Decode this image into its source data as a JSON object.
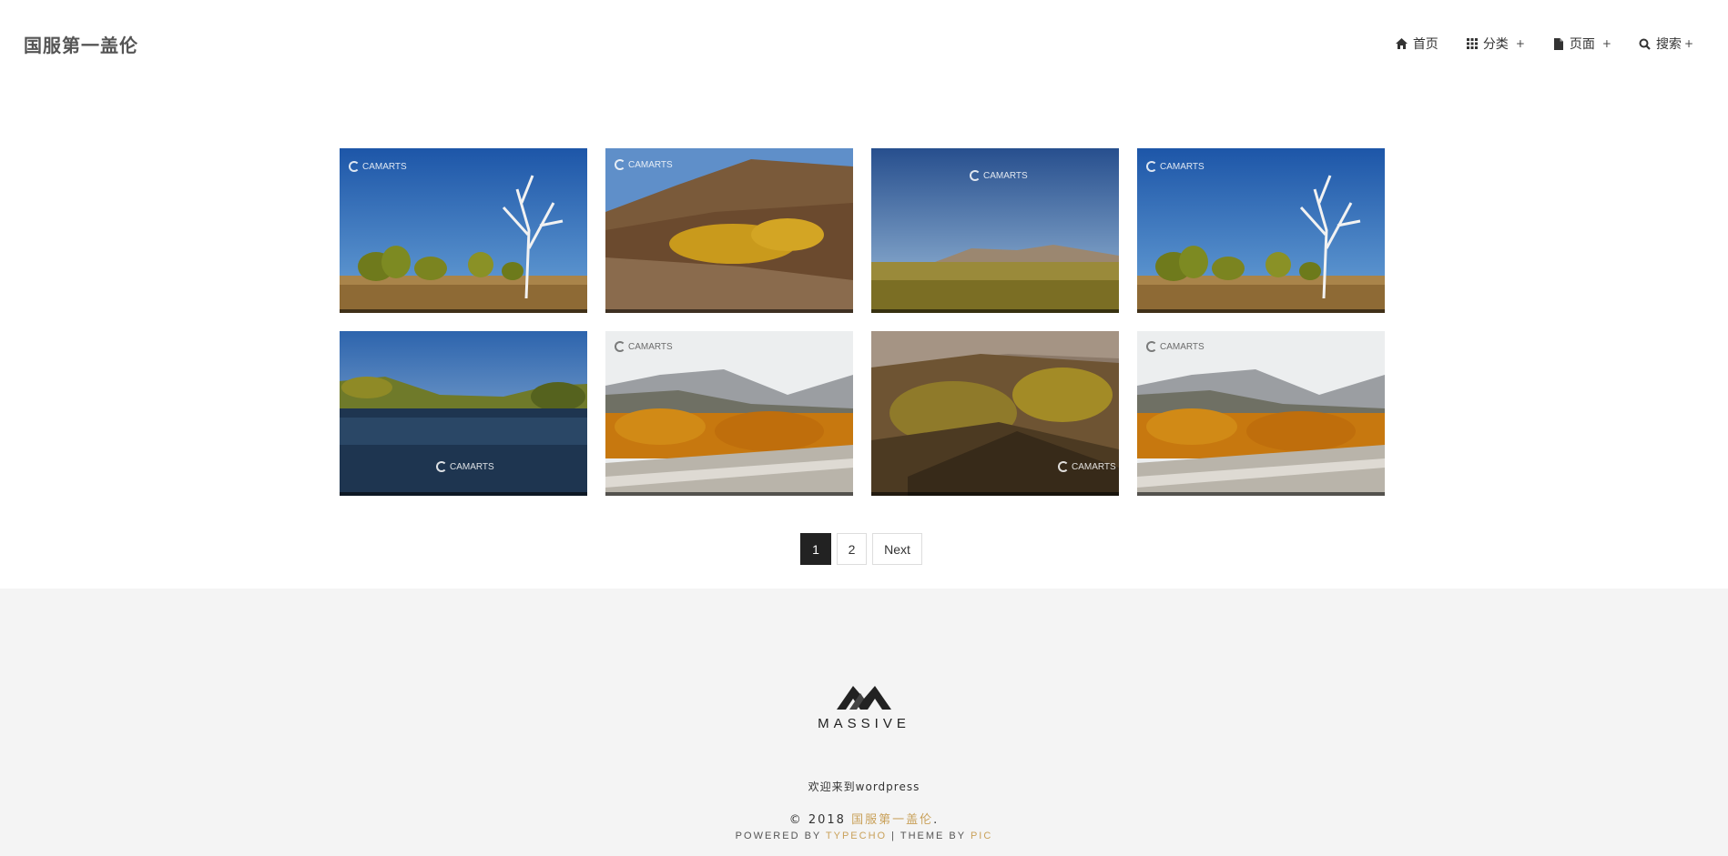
{
  "header": {
    "site_title": "国服第一盖伦",
    "nav": [
      {
        "label": "首页",
        "icon": "home-icon",
        "has_submenu": false
      },
      {
        "label": "分类",
        "icon": "grid-icon",
        "has_submenu": true
      },
      {
        "label": "页面",
        "icon": "file-icon",
        "has_submenu": true
      },
      {
        "label": "搜索",
        "icon": "search-icon",
        "has_submenu": true
      }
    ],
    "submenu_marker": "+"
  },
  "gallery": {
    "watermark": "CAMARTS",
    "items": [
      {
        "scene": "white-tree-blue-sky"
      },
      {
        "scene": "golden-hillside"
      },
      {
        "scene": "grassland-mountains"
      },
      {
        "scene": "white-tree-blue-sky"
      },
      {
        "scene": "river-trees"
      },
      {
        "scene": "autumn-valley-road"
      },
      {
        "scene": "forest-slope"
      },
      {
        "scene": "autumn-valley-road"
      }
    ]
  },
  "pagination": {
    "current": "1",
    "page2": "2",
    "next": "Next"
  },
  "footer": {
    "brand": "MASSIVE",
    "welcome": "欢迎来到wordpress",
    "copyright_prefix": "© 2018",
    "copyright_link": "国服第一盖伦",
    "copyright_suffix": ".",
    "powered_prefix": "POWERED BY",
    "powered_link": "TYPECHO",
    "separator": "|",
    "theme_prefix": "THEME BY",
    "theme_link": "PIC"
  },
  "colors": {
    "accent": "#c9a15a",
    "footer_bg": "#f4f4f4",
    "pager_active": "#222222"
  }
}
